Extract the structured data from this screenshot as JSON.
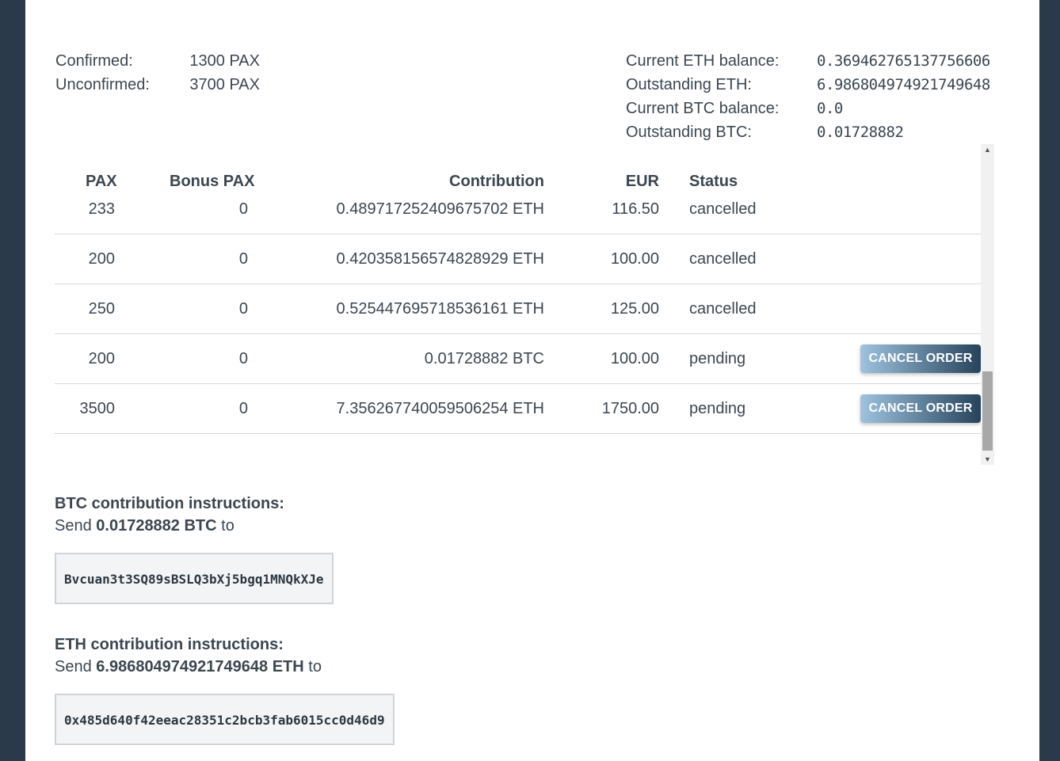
{
  "summary": {
    "confirmed_label": "Confirmed:",
    "confirmed_value": "1300 PAX",
    "unconfirmed_label": "Unconfirmed:",
    "unconfirmed_value": "3700 PAX",
    "eth_balance_label": "Current ETH balance:",
    "eth_balance_value": "0.369462765137756606",
    "outstanding_eth_label": "Outstanding ETH:",
    "outstanding_eth_value": "6.986804974921749648",
    "btc_balance_label": "Current BTC balance:",
    "btc_balance_value": "0.0",
    "outstanding_btc_label": "Outstanding BTC:",
    "outstanding_btc_value": "0.01728882"
  },
  "table": {
    "headers": {
      "pax": "PAX",
      "bonus": "Bonus PAX",
      "contribution": "Contribution",
      "eur": "EUR",
      "status": "Status"
    },
    "rows": [
      {
        "pax": "233",
        "bonus": "0",
        "contribution": "0.489717252409675702 ETH",
        "eur": "116.50",
        "status": "cancelled",
        "action": ""
      },
      {
        "pax": "200",
        "bonus": "0",
        "contribution": "0.420358156574828929 ETH",
        "eur": "100.00",
        "status": "cancelled",
        "action": ""
      },
      {
        "pax": "250",
        "bonus": "0",
        "contribution": "0.525447695718536161 ETH",
        "eur": "125.00",
        "status": "cancelled",
        "action": ""
      },
      {
        "pax": "200",
        "bonus": "0",
        "contribution": "0.01728882 BTC",
        "eur": "100.00",
        "status": "pending",
        "action": "CANCEL ORDER"
      },
      {
        "pax": "3500",
        "bonus": "0",
        "contribution": "7.356267740059506254 ETH",
        "eur": "1750.00",
        "status": "pending",
        "action": "CANCEL ORDER"
      }
    ]
  },
  "btc_instructions": {
    "title": "BTC contribution instructions:",
    "send_prefix": "Send ",
    "amount": "0.01728882 BTC",
    "send_suffix": " to",
    "address": "Bvcuan3t3SQ89sBSLQ3bXj5bgq1MNQkXJe"
  },
  "eth_instructions": {
    "title": "ETH contribution instructions:",
    "send_prefix": "Send ",
    "amount": "6.986804974921749648 ETH",
    "send_suffix": " to",
    "address": "0x485d640f42eeac28351c2bcb3fab6015cc0d46d9"
  },
  "colors": {
    "page_background": "#2b3a4a",
    "panel": "#ffffff",
    "button_gradient_start": "#9ec3df",
    "button_gradient_end": "#27435b"
  },
  "icons": {
    "scroll_up": "triangle-up-icon",
    "scroll_down": "triangle-down-icon"
  }
}
